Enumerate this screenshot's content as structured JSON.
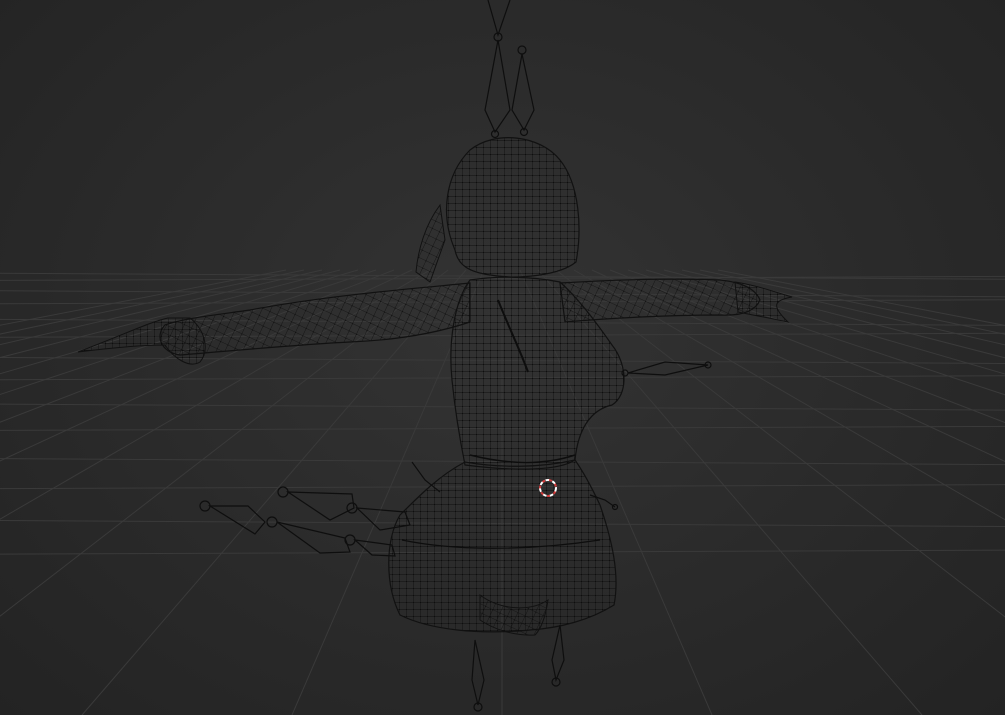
{
  "viewport": {
    "mode": "wireframe",
    "colors": {
      "background": "#2b2b2b",
      "grid": "#3a3a3a",
      "mesh": "#111111",
      "armature": "#0e0e0e",
      "cursor_red": "#d23b3b",
      "cursor_white": "#ffffff"
    },
    "objects": [
      {
        "id": "grid-floor",
        "kind": "ground-grid"
      },
      {
        "id": "character-mesh",
        "kind": "mesh",
        "display": "wireframe",
        "pose": "T-pose"
      },
      {
        "id": "armature",
        "kind": "armature",
        "display": "octahedral"
      }
    ],
    "cursor_icon": "3d-cursor-icon"
  }
}
